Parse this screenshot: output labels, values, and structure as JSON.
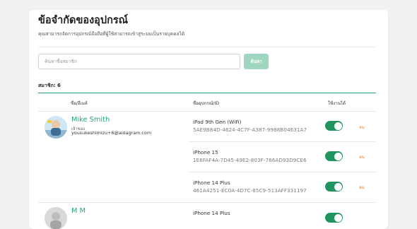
{
  "page": {
    "title": "ข้อจำกัดของอุปกรณ์",
    "subtitle": "คุณสามารถจัดการอุปกรณ์มือถือที่ผู้ใช้สามารถเข้าสู่ระบบเป็นรายบุคคลได้"
  },
  "search": {
    "placeholder": "ค้นหาชื่อสมาชิก",
    "button_label": "ค้นหา"
  },
  "member_count": "สมาชิก: 6",
  "table": {
    "headers": {
      "name": "ชื่อ/อีเมล์",
      "device": "ชื่ออุปกรณ์/ID",
      "enabled": "ใช้งานได้"
    },
    "delete_label": "ลบ",
    "members": [
      {
        "name": "Mike Smith",
        "role": "เจ้าของ",
        "email": "yousukeshimizu+6@aldagram.com",
        "devices": [
          {
            "name": "iPad 9th Gen (WiFi)",
            "id": "5AE9B84D-4624-4C7F-A387-9988B04631A7",
            "enabled": true
          },
          {
            "name": "iPhone 15",
            "id": "1E6FAF4A-7D45-49E2-803F-766AD93D9CE6",
            "enabled": true
          },
          {
            "name": "iPhone 14 Plus",
            "id": "461A4251-EC0A-4D7C-85C9-513AFF331197",
            "enabled": true
          }
        ]
      },
      {
        "name": "M M",
        "devices": [
          {
            "name": "iPhone 14 Plus",
            "enabled": true
          }
        ]
      }
    ]
  },
  "colors": {
    "accent": "#22945f",
    "accent_light": "#9ed6bf",
    "link_green": "#2aa37a",
    "delete_orange": "#e67b2f"
  }
}
